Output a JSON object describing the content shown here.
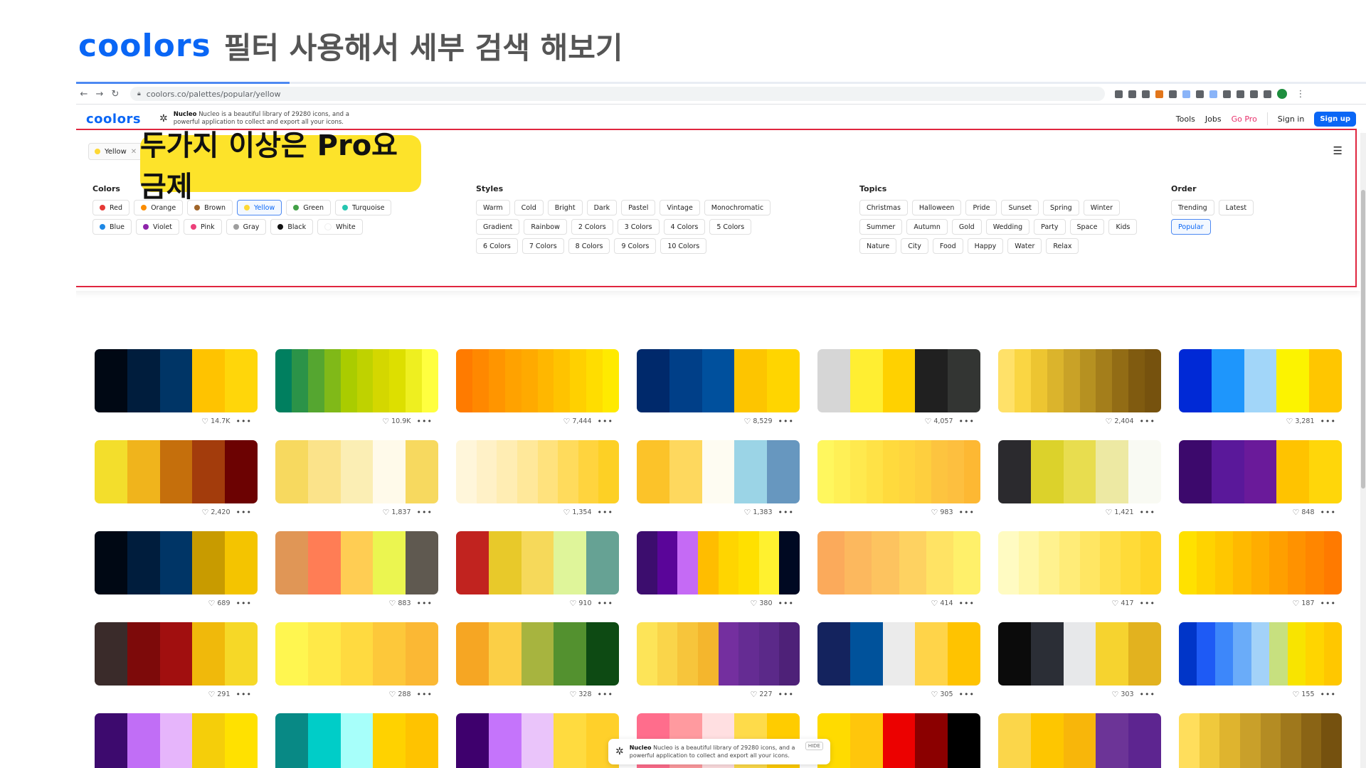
{
  "slide": {
    "logo": "coolors",
    "heading": "필터 사용해서 세부 검색 해보기"
  },
  "browser": {
    "url": "coolors.co/palettes/popular/yellow"
  },
  "site": {
    "logo": "coolors",
    "ad_title": "Nucleo",
    "ad_text": "Nucleo is a beautiful library of 29280 icons, and a powerful application to collect and export all your icons.",
    "nav": {
      "tools": "Tools",
      "jobs": "Jobs",
      "gopro": "Go Pro",
      "signin": "Sign in",
      "signup": "Sign up"
    }
  },
  "filter": {
    "active_chip": "Yellow",
    "callout": "두가지 이상은 Pro요금제",
    "groups": {
      "colors": {
        "title": "Colors",
        "items": [
          {
            "label": "Red",
            "dot": "#e53935"
          },
          {
            "label": "Orange",
            "dot": "#fb8c00"
          },
          {
            "label": "Brown",
            "dot": "#a0652a"
          },
          {
            "label": "Yellow",
            "dot": "#fdd835"
          },
          {
            "label": "Green",
            "dot": "#43a047"
          },
          {
            "label": "Turquoise",
            "dot": "#26c6b0"
          },
          {
            "label": "Blue",
            "dot": "#1e88e5"
          },
          {
            "label": "Violet",
            "dot": "#8e24aa"
          },
          {
            "label": "Pink",
            "dot": "#ec407a"
          },
          {
            "label": "Gray",
            "dot": "#9e9e9e"
          },
          {
            "label": "Black",
            "dot": "#111111"
          },
          {
            "label": "White",
            "dot": "#ffffff"
          }
        ]
      },
      "styles": {
        "title": "Styles",
        "items": [
          "Warm",
          "Cold",
          "Bright",
          "Dark",
          "Pastel",
          "Vintage",
          "Monochromatic",
          "Gradient",
          "Rainbow",
          "2 Colors",
          "3 Colors",
          "4 Colors",
          "5 Colors",
          "6 Colors",
          "7 Colors",
          "8 Colors",
          "9 Colors",
          "10 Colors"
        ]
      },
      "topics": {
        "title": "Topics",
        "items": [
          "Christmas",
          "Halloween",
          "Pride",
          "Sunset",
          "Spring",
          "Winter",
          "Summer",
          "Autumn",
          "Gold",
          "Wedding",
          "Party",
          "Space",
          "Kids",
          "Nature",
          "City",
          "Food",
          "Happy",
          "Water",
          "Relax"
        ]
      },
      "order": {
        "title": "Order",
        "items": [
          "Trending",
          "Latest",
          "Popular"
        ]
      }
    },
    "selected_color": "Yellow",
    "selected_order": "Popular"
  },
  "palettes": [
    {
      "likes": "14.7K",
      "colors": [
        "#000814",
        "#001d3d",
        "#003566",
        "#ffc300",
        "#ffd60a"
      ]
    },
    {
      "likes": "10.9K",
      "colors": [
        "#007f5f",
        "#2b9348",
        "#55a630",
        "#80b918",
        "#aacc00",
        "#bfd200",
        "#d4d700",
        "#dddf00",
        "#eeef20",
        "#ffff3f"
      ]
    },
    {
      "likes": "7,444",
      "colors": [
        "#ff7b00",
        "#ff8800",
        "#ff9500",
        "#ffa200",
        "#ffaa00",
        "#ffb700",
        "#ffc300",
        "#ffd000",
        "#ffdd00",
        "#ffea00"
      ]
    },
    {
      "likes": "8,529",
      "colors": [
        "#00296b",
        "#003f88",
        "#00509d",
        "#fdc500",
        "#ffd500"
      ]
    },
    {
      "likes": "4,057",
      "colors": [
        "#d6d6d6",
        "#ffee32",
        "#ffd100",
        "#202020",
        "#333533"
      ]
    },
    {
      "likes": "2,404",
      "colors": [
        "#ffe169",
        "#fad643",
        "#edc531",
        "#dbb42c",
        "#c9a227",
        "#b69121",
        "#a47e1b",
        "#926c15",
        "#805b10",
        "#76520e"
      ]
    },
    {
      "likes": "3,281",
      "colors": [
        "#0029d6",
        "#1e96fc",
        "#a2d6f9",
        "#fcf300",
        "#ffc600"
      ]
    },
    {
      "likes": "2,420",
      "colors": [
        "#f3de2c",
        "#f0b41c",
        "#c56f0c",
        "#a33c0c",
        "#6c0202"
      ]
    },
    {
      "likes": "1,837",
      "colors": [
        "#f7d95f",
        "#fbe38a",
        "#fbeeb4",
        "#fffaea",
        "#f7d95f"
      ]
    },
    {
      "likes": "1,354",
      "colors": [
        "#fff6da",
        "#fff1c7",
        "#ffedb3",
        "#ffe89a",
        "#ffe27d",
        "#ffdb5c",
        "#ffd43e",
        "#fdd025"
      ]
    },
    {
      "likes": "1,383",
      "colors": [
        "#fcc329",
        "#fed85e",
        "#fefcf2",
        "#9bd4e6",
        "#6797bf"
      ]
    },
    {
      "likes": "983",
      "colors": [
        "#fff75e",
        "#fff056",
        "#ffe94e",
        "#ffe246",
        "#ffda3d",
        "#ffd53e",
        "#fecf3e",
        "#fdc43f",
        "#fdbf3f",
        "#fdb833"
      ]
    },
    {
      "likes": "1,421",
      "colors": [
        "#2b2a2e",
        "#dcd22b",
        "#e8dd4f",
        "#ede9a3",
        "#f9faf3"
      ]
    },
    {
      "likes": "848",
      "colors": [
        "#3c096c",
        "#5a189a",
        "#6a1a9a",
        "#ffc300",
        "#ffd60a"
      ]
    },
    {
      "likes": "689",
      "colors": [
        "#000814",
        "#001d3d",
        "#003566",
        "#c89b00",
        "#f4c400"
      ]
    },
    {
      "likes": "883",
      "colors": [
        "#e09656",
        "#ff7d55",
        "#ffcd53",
        "#ebf550",
        "#5f5950"
      ]
    },
    {
      "likes": "910",
      "colors": [
        "#c1231f",
        "#e8c92a",
        "#f6d95a",
        "#dff59a",
        "#66a294"
      ]
    },
    {
      "likes": "380",
      "colors": [
        "#3c0d6e",
        "#5a0599",
        "#c56af5",
        "#ffbd00",
        "#ffd500",
        "#ffe000",
        "#fff12f",
        "#000922"
      ]
    },
    {
      "likes": "414",
      "colors": [
        "#fbaa5b",
        "#fcb85e",
        "#fdc35f",
        "#fed261",
        "#ffe364",
        "#fff06a"
      ]
    },
    {
      "likes": "417",
      "colors": [
        "#fffbc2",
        "#fff7a8",
        "#fff28f",
        "#ffec78",
        "#ffe663",
        "#ffe04d",
        "#ffdb38",
        "#ffd526"
      ]
    },
    {
      "likes": "187",
      "colors": [
        "#ffe100",
        "#ffd300",
        "#ffc700",
        "#ffb900",
        "#ffad00",
        "#ff9f00",
        "#ff9200",
        "#ff8600",
        "#ff7a00"
      ]
    },
    {
      "likes": "291",
      "colors": [
        "#3a2b2a",
        "#7d0a0a",
        "#a10f0f",
        "#f0b90b",
        "#f6d827"
      ]
    },
    {
      "likes": "288",
      "colors": [
        "#fff650",
        "#ffe948",
        "#ffda40",
        "#fdc83a",
        "#fbb834"
      ]
    },
    {
      "likes": "328",
      "colors": [
        "#f6a623",
        "#fbcf46",
        "#a7b43f",
        "#53912f",
        "#0d4a13"
      ]
    },
    {
      "likes": "227",
      "colors": [
        "#fde458",
        "#fad54a",
        "#f7c53b",
        "#f4b62d",
        "#742f9f",
        "#652c93",
        "#5b2989",
        "#4e2178"
      ]
    },
    {
      "likes": "305",
      "colors": [
        "#14235e",
        "#00529b",
        "#ebebeb",
        "#ffd449",
        "#ffc300"
      ]
    },
    {
      "likes": "303",
      "colors": [
        "#0b0b0b",
        "#2b2e36",
        "#e7e8ea",
        "#f6d32f",
        "#e2b21f"
      ]
    },
    {
      "likes": "155",
      "colors": [
        "#0035c8",
        "#1e5af5",
        "#3d87fa",
        "#6aacf9",
        "#a3d2f8",
        "#c7e07f",
        "#f8e400",
        "#ffd500",
        "#ffc700"
      ]
    },
    {
      "likes": "",
      "colors": [
        "#3d0a6e",
        "#c16ef6",
        "#e6b5fb",
        "#f5ce0a",
        "#ffe100"
      ]
    },
    {
      "likes": "",
      "colors": [
        "#088985",
        "#00cdc8",
        "#a7fffa",
        "#ffd200",
        "#ffc300"
      ]
    },
    {
      "likes": "",
      "colors": [
        "#3e006d",
        "#c574fb",
        "#eac4fa",
        "#ffdb3f",
        "#ffd02a"
      ]
    },
    {
      "likes": "",
      "colors": [
        "#ff6d8c",
        "#ff9a9f",
        "#ffdfe1",
        "#fedb4a",
        "#ffcc00"
      ]
    },
    {
      "likes": "",
      "colors": [
        "#ffdb00",
        "#ffc60c",
        "#ec0100",
        "#8b0000",
        "#000000"
      ]
    },
    {
      "likes": "",
      "colors": [
        "#fbd64a",
        "#fec600",
        "#f8b60a",
        "#6c3497",
        "#5d2590"
      ]
    },
    {
      "likes": "",
      "colors": [
        "#ffde5c",
        "#f0c93c",
        "#dfb42e",
        "#c9a02a",
        "#b48c23",
        "#9f781c",
        "#8a6415",
        "#75510f"
      ]
    }
  ],
  "popup": {
    "title": "Nucleo",
    "text": "Nucleo is a beautiful library of 29280 icons, and a powerful application to collect and export all your icons.",
    "hide": "HIDE"
  }
}
